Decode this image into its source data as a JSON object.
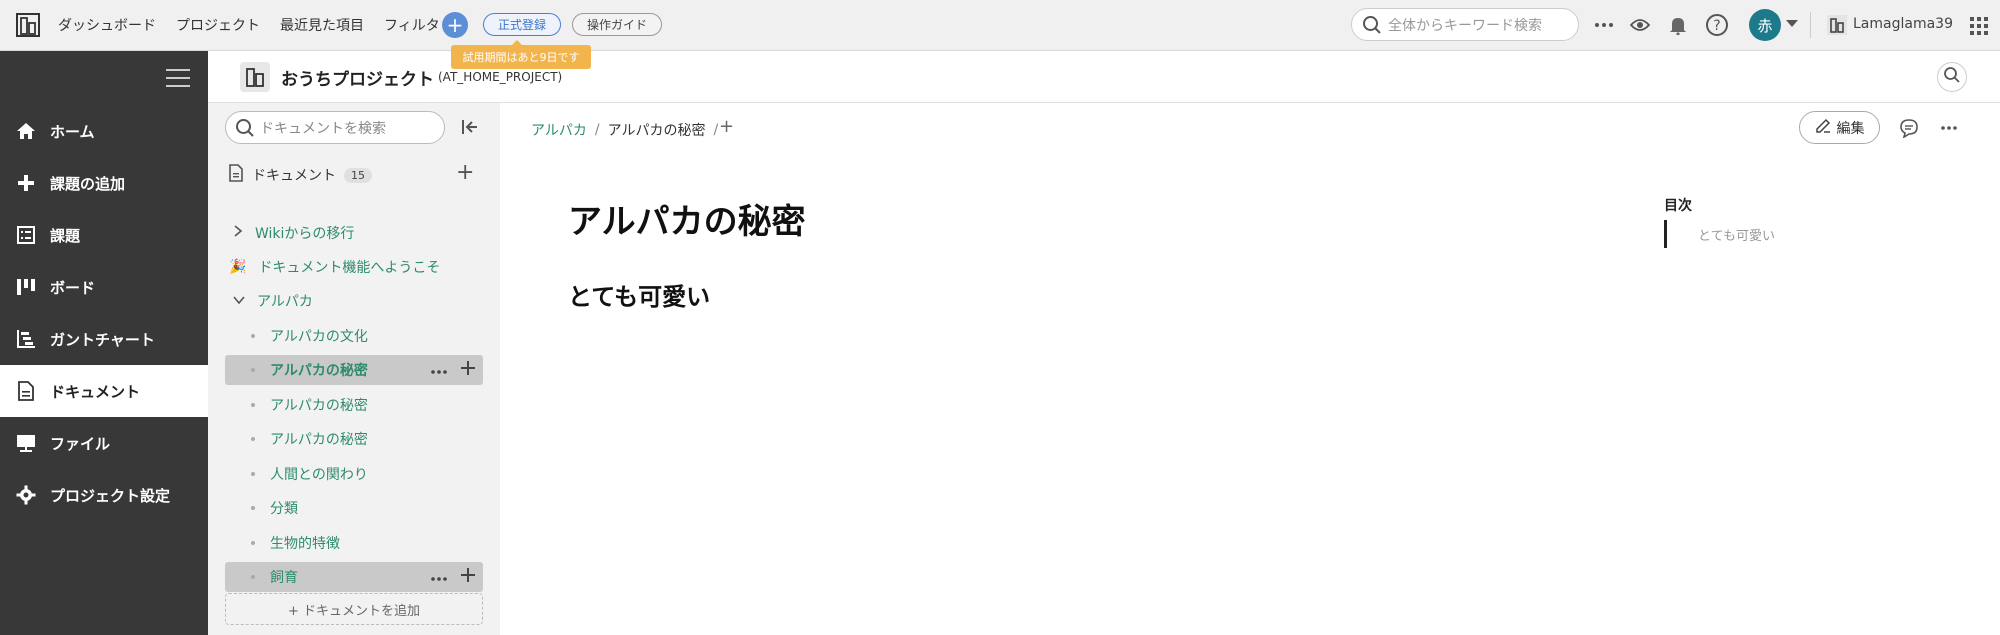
{
  "topbar": {
    "nav": [
      "ダッシュボード",
      "プロジェクト",
      "最近見た項目",
      "フィルタ"
    ],
    "register_label": "正式登録",
    "guide_label": "操作ガイド",
    "trial_notice": "試用期間はあと9日です",
    "search_placeholder": "全体からキーワード検索",
    "avatar_initial": "赤",
    "space_name": "Lamaglama39"
  },
  "sidebar": {
    "items": [
      {
        "label": "ホーム",
        "icon": "home-icon"
      },
      {
        "label": "課題の追加",
        "icon": "plus-icon"
      },
      {
        "label": "課題",
        "icon": "list-icon"
      },
      {
        "label": "ボード",
        "icon": "board-icon"
      },
      {
        "label": "ガントチャート",
        "icon": "gantt-icon"
      },
      {
        "label": "ドキュメント",
        "icon": "document-icon"
      },
      {
        "label": "ファイル",
        "icon": "file-icon"
      },
      {
        "label": "プロジェクト設定",
        "icon": "gear-icon"
      }
    ]
  },
  "project": {
    "name": "おうちプロジェクト",
    "key": "(AT_HOME_PROJECT)"
  },
  "tree": {
    "search_placeholder": "ドキュメントを検索",
    "heading": "ドキュメント",
    "count": "15",
    "items": [
      {
        "label": "Wikiからの移行"
      },
      {
        "label": "ドキュメント機能へようこそ",
        "emoji": "🎉"
      },
      {
        "label": "アルパカ"
      },
      {
        "label": "アルパカの文化"
      },
      {
        "label": "アルパカの秘密"
      },
      {
        "label": "アルパカの秘密"
      },
      {
        "label": "アルパカの秘密"
      },
      {
        "label": "人間との関わり"
      },
      {
        "label": "分類"
      },
      {
        "label": "生物的特徴"
      },
      {
        "label": "飼育"
      }
    ],
    "add_doc_label": "+ ドキュメントを追加"
  },
  "main": {
    "breadcrumb": [
      "アルパカ",
      "アルパカの秘密"
    ],
    "edit_label": "編集",
    "title": "アルパカの秘密",
    "heading": "とても可愛い",
    "toc_title": "目次",
    "toc_items": [
      "とても可愛い"
    ]
  },
  "colors": {
    "sidebar_bg": "#383838",
    "link_green": "#2e8b6f",
    "accent_blue": "#5d8fd6",
    "trial_orange": "#f2b54e",
    "avatar_teal": "#1c7a8b"
  }
}
